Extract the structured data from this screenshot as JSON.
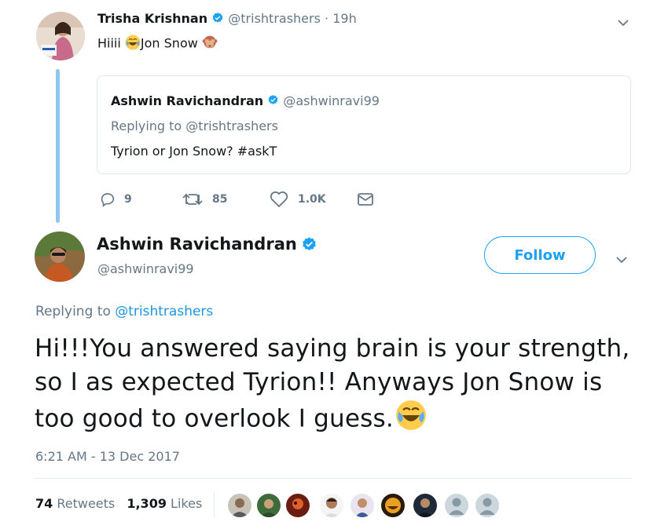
{
  "parent_tweet": {
    "name": "Trisha Krishnan",
    "handle": "@trishtrashers",
    "time": "· 19h",
    "text_before": "Hiiii ",
    "text_after": "Jon Snow "
  },
  "quoted_tweet": {
    "name": "Ashwin Ravichandran",
    "handle": "@ashwinravi99",
    "replying_prefix": "Replying to ",
    "replying_handle": "@trishtrashers",
    "text": "Tyrion or Jon Snow? #askT"
  },
  "parent_actions": {
    "replies": "9",
    "retweets": "85",
    "likes": "1.0K"
  },
  "main_tweet": {
    "name": "Ashwin Ravichandran",
    "handle": "@ashwinravi99",
    "follow_label": "Follow",
    "replying_prefix": "Replying to ",
    "replying_handle": "@trishtrashers",
    "text": "Hi!!!You answered saying brain is your strength, so I as expected Tyrion!! Anyways Jon Snow is too good to overlook I guess.",
    "timestamp": "6:21 AM - 13 Dec 2017"
  },
  "stats": {
    "retweets_count": "74",
    "retweets_label": " Retweets",
    "likes_count": "1,309",
    "likes_label": " Likes"
  },
  "colors": {
    "accent": "#1da1f2",
    "verified": "#1da1f2",
    "muted": "#657786",
    "thread_line": "#8ec7ef"
  },
  "icons": [
    "verified-icon",
    "chevron-down-icon",
    "reply-icon",
    "retweet-icon",
    "like-icon",
    "dm-icon",
    "laughing-emoji",
    "see-no-evil-emoji"
  ]
}
